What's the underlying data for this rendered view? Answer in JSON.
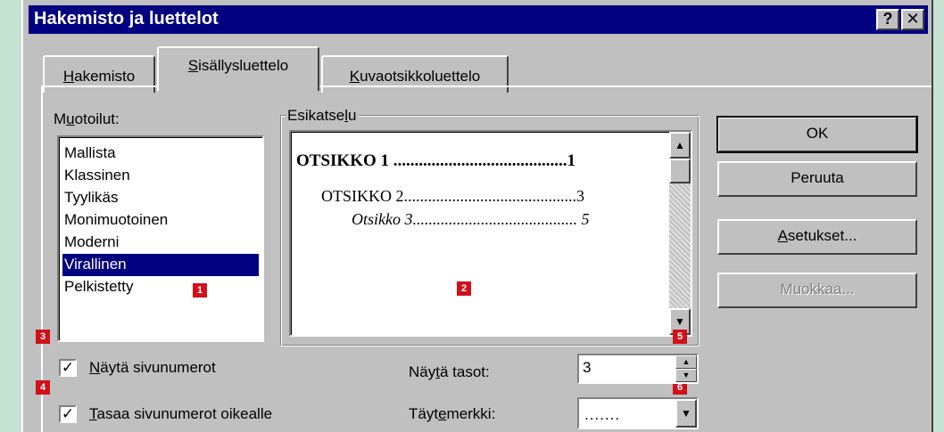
{
  "window": {
    "title": "Hakemisto ja luettelot",
    "help_button": "?",
    "close_button": "✕"
  },
  "tabs": [
    {
      "label": "Hakemisto",
      "mnemonic": "H",
      "rest": "akemisto"
    },
    {
      "label": "Sisällysluettelo",
      "mnemonic": "S",
      "rest": "isällysluettelo",
      "active": true
    },
    {
      "label": "Kuvaotsikkoluettelo",
      "mnemonic": "K",
      "rest": "uvaotsikkoluettelo"
    }
  ],
  "formats": {
    "label_pre": "M",
    "label_mn": "u",
    "label_post": "otoilut:",
    "items": [
      "Mallista",
      "Klassinen",
      "Tyylikäs",
      "Monimuotoinen",
      "Moderni",
      "Virallinen",
      "Pelkistetty"
    ],
    "selected": "Virallinen"
  },
  "preview": {
    "label_pre": "Esikatse",
    "label_mn": "l",
    "label_post": "u",
    "heading1": "OTSIKKO 1 .........................................1",
    "heading2": "OTSIKKO 2...........................................3",
    "heading3": "Otsikko 3......................................... 5"
  },
  "buttons": {
    "ok": "OK",
    "cancel": "Peruuta",
    "settings_mn": "A",
    "settings_rest": "setukset...",
    "modify": "Muokkaa..."
  },
  "options": {
    "show_page_numbers_mn": "N",
    "show_page_numbers_rest": "äytä sivunumerot",
    "show_page_numbers_checked": true,
    "align_right_mn": "T",
    "align_right_rest": "asaa sivunumerot oikealle",
    "align_right_checked": true,
    "show_levels_pre": "Näy",
    "show_levels_mn": "t",
    "show_levels_post": "ä tasot:",
    "show_levels_value": "3",
    "fill_char_pre": "Täyt",
    "fill_char_mn": "e",
    "fill_char_post": "merkki:",
    "fill_char_value": "......."
  },
  "badges": [
    "1",
    "2",
    "3",
    "4",
    "5",
    "6"
  ],
  "colors": {
    "titlebar": "#000080",
    "dialog_face": "#c0c0c0",
    "selection": "#000080",
    "badge": "#d0101a",
    "backdrop": "#c6e3d3"
  }
}
